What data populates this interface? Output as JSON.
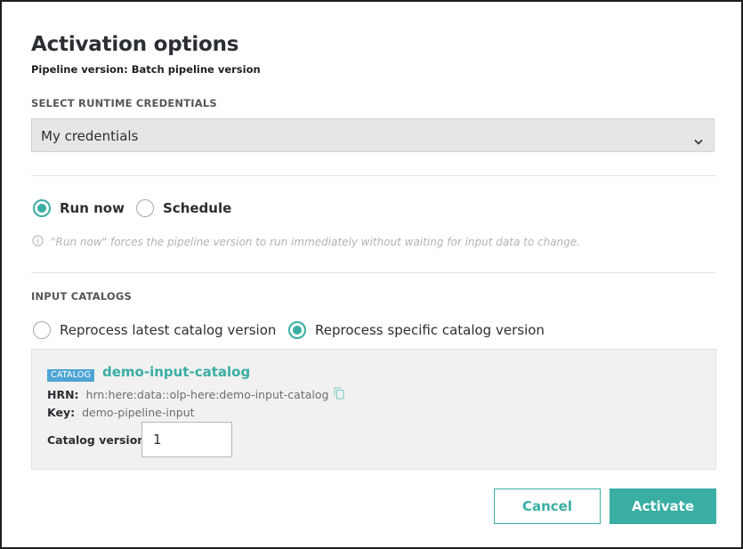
{
  "dialog": {
    "title": "Activation options",
    "subtitle": "Pipeline version: Batch pipeline version"
  },
  "credentials": {
    "section_label": "SELECT RUNTIME CREDENTIALS",
    "selected": "My credentials"
  },
  "run_mode": {
    "options": [
      {
        "label": "Run now",
        "checked": true
      },
      {
        "label": "Schedule",
        "checked": false
      }
    ],
    "hint": "\"Run now\" forces the pipeline version to run immediately without waiting for input data to change."
  },
  "input_catalogs": {
    "section_label": "INPUT CATALOGS",
    "options": [
      {
        "label": "Reprocess latest catalog version",
        "checked": false
      },
      {
        "label": "Reprocess specific catalog version",
        "checked": true
      }
    ],
    "catalog": {
      "badge": "CATALOG",
      "name": "demo-input-catalog",
      "hrn_label": "HRN:",
      "hrn": "hrn:here:data::olp-here:demo-input-catalog",
      "key_label": "Key:",
      "key": "demo-pipeline-input",
      "version_label": "Catalog version:",
      "version_value": "1"
    }
  },
  "actions": {
    "cancel": "Cancel",
    "activate": "Activate"
  },
  "colors": {
    "accent": "#3aaea3",
    "badge": "#4ea4d4"
  }
}
